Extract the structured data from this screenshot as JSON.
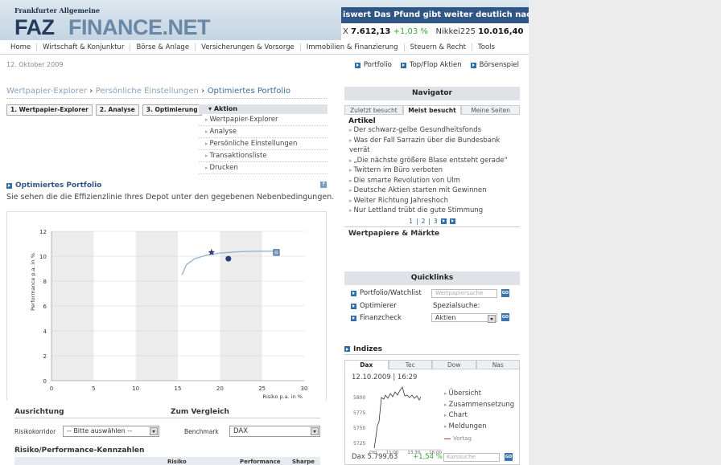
{
  "header": {
    "faz_small": "Frankfurter Allgemeine",
    "logo_faz": "FAZ",
    "logo_finance": "FINANCE.NET",
    "ticker_news": "iswert   Das Pfund gibt weiter deutlich nach",
    "quote1_prefix": "X",
    "quote1_value": "7.612,13",
    "quote1_change": "+1,03 %",
    "quote2_name": "Nikkei225",
    "quote2_value": "10.016,40"
  },
  "mainnav": [
    "Home",
    "Wirtschaft & Konjunktur",
    "Börse & Anlage",
    "Versicherungen & Vorsorge",
    "Immobilien & Finanzierung",
    "Steuern & Recht",
    "Tools"
  ],
  "date": "12. Oktober 2009",
  "toplinks": [
    "Portfolio",
    "Top/Flop Aktien",
    "Börsenspiel"
  ],
  "breadcrumb": {
    "b1": "Wertpapier-Explorer",
    "b2": "Persönliche Einstellungen",
    "b3": "Optimiertes Portfolio"
  },
  "steps": [
    "1. Wertpapier-Explorer",
    "2. Analyse",
    "3. Optimierung"
  ],
  "action": {
    "title": "Aktion",
    "items": [
      "Wertpapier-Explorer",
      "Analyse",
      "Persönliche Einstellungen",
      "Transaktionsliste",
      "Drucken"
    ]
  },
  "portfolio": {
    "title": "Optimiertes Portfolio",
    "intro": "Sie sehen die die Effizienzlinie Ihres Depot unter den gegebenen Nebenbedingungen."
  },
  "chart_data": {
    "type": "scatter",
    "ylabel": "Performance p.a. in %",
    "xlabel": "Risiko p.a. in %",
    "xlim": [
      0,
      30
    ],
    "ylim": [
      0,
      12
    ],
    "xticks": [
      0,
      5,
      10,
      15,
      20,
      25,
      30
    ],
    "yticks": [
      0,
      2,
      4,
      6,
      8,
      10,
      12
    ],
    "series": [
      {
        "values": [
          [
            15.5,
            8.5
          ],
          [
            16,
            9.3
          ],
          [
            17,
            9.8
          ],
          [
            18.5,
            10.1
          ],
          [
            20,
            10.25
          ],
          [
            22,
            10.35
          ],
          [
            24,
            10.4
          ],
          [
            26,
            10.4
          ],
          [
            27,
            10.4
          ]
        ]
      }
    ],
    "points": [
      {
        "shape": "star",
        "x": 19,
        "y": 10.3
      },
      {
        "shape": "circle",
        "x": 21,
        "y": 9.8
      },
      {
        "shape": "square",
        "x": 26.7,
        "y": 10.3
      }
    ]
  },
  "settings": {
    "ausrichtung": "Ausrichtung",
    "vergleich": "Zum Vergleich",
    "risikokorridor_label": "Risikokorridor",
    "risikokorridor_value": "-- Bitte auswählen --",
    "benchmark_label": "Benchmark",
    "benchmark_value": "DAX",
    "kennzahlen": "Risiko/Performance-Kennzahlen",
    "col1": "Risiko",
    "col2": "Performance",
    "col3": "Sharpe"
  },
  "navigator": {
    "title": "Navigator",
    "tabs": [
      "Zuletzt besucht",
      "Meist besucht",
      "Meine Seiten"
    ],
    "section": "Artikel",
    "articles": [
      "Der schwarz-gelbe Gesundheitsfonds",
      "Was der Fall Sarrazin über die Bundesbank verrät",
      "„Die nächste größere Blase entsteht gerade“",
      "Twittern im Büro verboten",
      "Die smarte Revolution von Ulm",
      "Deutsche Aktien starten mit Gewinnen",
      "Weiter Richtung Jahreshoch",
      "Nur Lettland trübt die gute Stimmung"
    ],
    "pages": [
      "1",
      "2",
      "3"
    ],
    "footer": "Wertpapiere & Märkte"
  },
  "quicklinks": {
    "title": "Quicklinks",
    "l1": "Portfolio/Watchlist",
    "l2": "Optimierer",
    "l3": "Finanzcheck",
    "search_placeholder": "Wertpapiersuche",
    "spezial": "Spezialsuche:",
    "select": "Aktien",
    "go": "GO"
  },
  "indizes": {
    "title": "Indizes",
    "tabs": [
      "Dax",
      "Tec",
      "Dow",
      "Nas"
    ],
    "datetime": "12.10.2009 | 16:29",
    "links": [
      "Übersicht",
      "Zusammensetzung",
      "Chart",
      "Meldungen"
    ],
    "vortag": "Vortag",
    "dax": "Dax 5.799,63",
    "change": "+1,54 %",
    "kurssuche": "Kurssuche",
    "yticks": [
      "5800",
      "5775",
      "5750",
      "5725"
    ],
    "xticks": [
      "Okt",
      "11:00",
      "13:30",
      "16:00"
    ]
  },
  "colors": {
    "brand_blue": "#2f5684",
    "accent": "#3c75ae",
    "up": "#3aa53a"
  }
}
